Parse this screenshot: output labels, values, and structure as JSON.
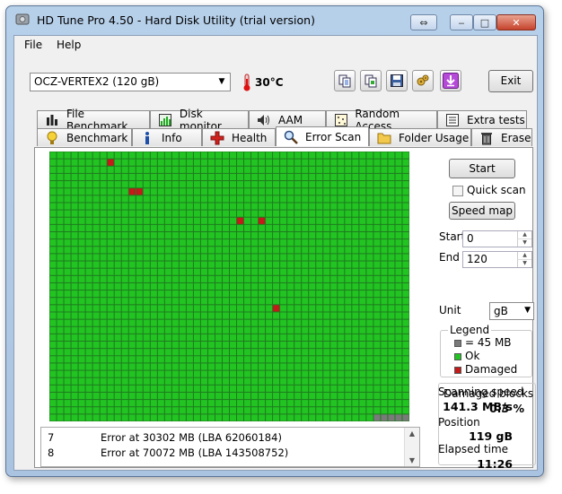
{
  "window": {
    "title": "HD Tune Pro 4.50 - Hard Disk Utility (trial version)",
    "controls": {
      "restore": "⇔",
      "minimize": "‒",
      "maximize": "□",
      "close": "✕"
    }
  },
  "menu": {
    "file": "File",
    "help": "Help"
  },
  "toolbar": {
    "drive": "OCZ-VERTEX2 (120 gB)",
    "temperature": "30°C",
    "icons": [
      "copy-text-icon",
      "copy-screenshot-icon",
      "save-icon",
      "options-icon",
      "download-icon"
    ],
    "exit_label": "Exit"
  },
  "tabs": {
    "row1": [
      {
        "label": "File Benchmark",
        "icon": "file-benchmark-icon"
      },
      {
        "label": "Disk monitor",
        "icon": "disk-monitor-icon"
      },
      {
        "label": "AAM",
        "icon": "speaker-icon"
      },
      {
        "label": "Random Access",
        "icon": "random-access-icon"
      },
      {
        "label": "Extra tests",
        "icon": "extra-tests-icon"
      }
    ],
    "row2": [
      {
        "label": "Benchmark",
        "icon": "benchmark-icon"
      },
      {
        "label": "Info",
        "icon": "info-icon"
      },
      {
        "label": "Health",
        "icon": "health-icon"
      },
      {
        "label": "Error Scan",
        "icon": "magnifier-icon",
        "active": true
      },
      {
        "label": "Folder Usage",
        "icon": "folder-icon"
      },
      {
        "label": "Erase",
        "icon": "trash-icon"
      }
    ]
  },
  "scan": {
    "columns": 50,
    "rows": 37,
    "block_count_scanned": 1845,
    "damaged_blocks": [
      [
        1,
        8
      ],
      [
        5,
        11
      ],
      [
        5,
        12
      ],
      [
        9,
        26
      ],
      [
        9,
        29
      ],
      [
        21,
        31
      ]
    ],
    "unscanned_tail": 5,
    "colors": {
      "ok": "#22c422",
      "damaged": "#c41a1a",
      "unscanned": "#7a7a7a",
      "gridline": "#1e6e1e"
    }
  },
  "log": [
    {
      "n": "7",
      "text": "Error at 30302 MB (LBA 62060184)"
    },
    {
      "n": "8",
      "text": "Error at 70072 MB (LBA 143508752)"
    }
  ],
  "controls": {
    "start_label": "Start",
    "quick_scan_label": "Quick scan",
    "quick_scan_checked": false,
    "speed_map_label": "Speed map",
    "start_field_label": "Start",
    "start_value": "0",
    "end_field_label": "End",
    "end_value": "120",
    "unit_label": "Unit",
    "unit_value": "gB"
  },
  "legend": {
    "title": "Legend",
    "block_size": "= 45 MB",
    "ok": "Ok",
    "damaged": "Damaged"
  },
  "stats": {
    "damaged_blocks_label": "Damaged blocks",
    "damaged_blocks_value": "0.3 %",
    "scanning_speed_label": "Scanning speed",
    "scanning_speed_value": "141.3 MB/s",
    "position_label": "Position",
    "position_value": "119 gB",
    "elapsed_label": "Elapsed time",
    "elapsed_value": "11:26"
  }
}
